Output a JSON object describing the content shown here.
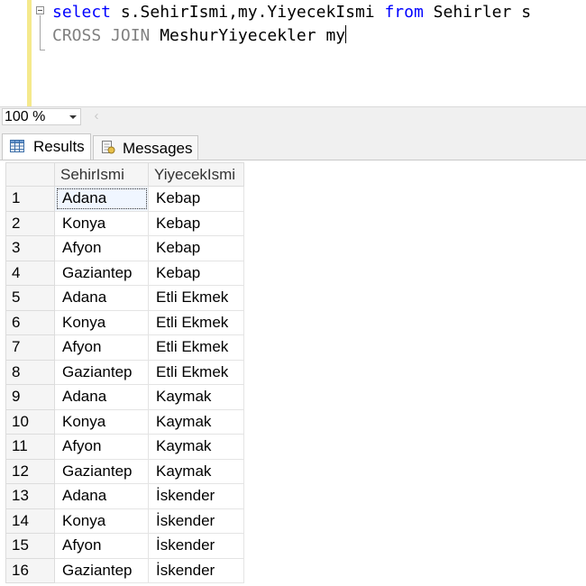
{
  "editor": {
    "line1": {
      "kw_select": "select",
      "columns": " s.SehirIsmi,my.YiyecekIsmi ",
      "kw_from": "from",
      "table": " Sehirler s"
    },
    "line2": {
      "kw_cross_join": "CROSS JOIN",
      "table": " MeshurYiyecekler my"
    }
  },
  "zoom": {
    "value": "100 %"
  },
  "tabs": {
    "results": "Results",
    "messages": "Messages"
  },
  "grid": {
    "headers": [
      "",
      "SehirIsmi",
      "YiyecekIsmi"
    ],
    "rows": [
      [
        "1",
        "Adana",
        "Kebap"
      ],
      [
        "2",
        "Konya",
        "Kebap"
      ],
      [
        "3",
        "Afyon",
        "Kebap"
      ],
      [
        "4",
        "Gaziantep",
        "Kebap"
      ],
      [
        "5",
        "Adana",
        "Etli Ekmek"
      ],
      [
        "6",
        "Konya",
        "Etli Ekmek"
      ],
      [
        "7",
        "Afyon",
        "Etli Ekmek"
      ],
      [
        "8",
        "Gaziantep",
        "Etli Ekmek"
      ],
      [
        "9",
        "Adana",
        "Kaymak"
      ],
      [
        "10",
        "Konya",
        "Kaymak"
      ],
      [
        "11",
        "Afyon",
        "Kaymak"
      ],
      [
        "12",
        "Gaziantep",
        "Kaymak"
      ],
      [
        "13",
        "Adana",
        "İskender"
      ],
      [
        "14",
        "Konya",
        "İskender"
      ],
      [
        "15",
        "Afyon",
        "İskender"
      ],
      [
        "16",
        "Gaziantep",
        "İskender"
      ]
    ]
  },
  "colors": {
    "keyword": "#0000ff",
    "keyword_gray": "#808080",
    "margin": "#f5e98c"
  }
}
